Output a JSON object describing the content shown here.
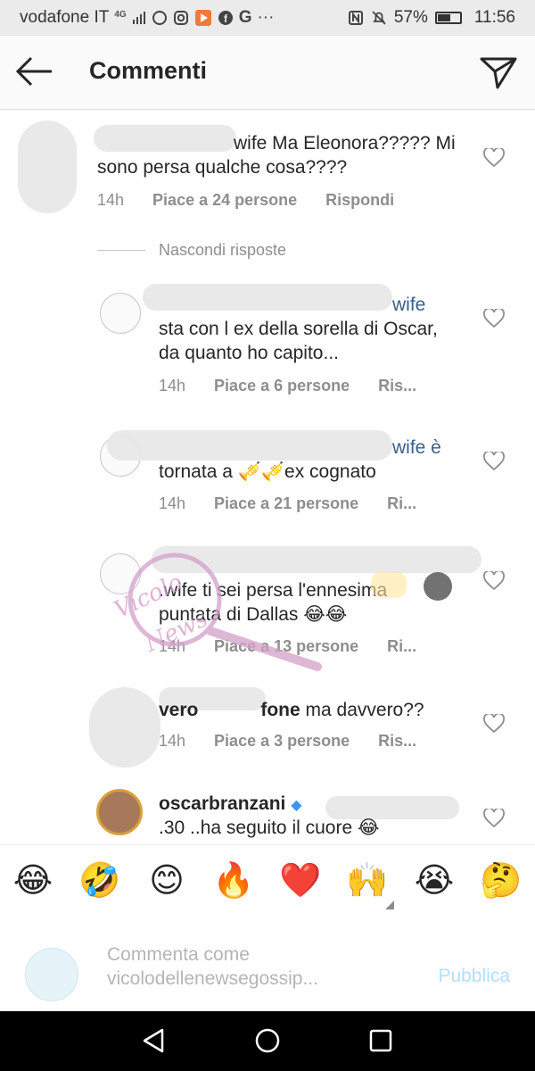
{
  "status_bar": {
    "carrier": "vodafone IT",
    "network": "4G",
    "battery": "57%",
    "time": "11:56",
    "battery_level": 0.57
  },
  "header": {
    "title": "Commenti",
    "back_icon": "arrow-left-icon",
    "send_icon": "paper-plane-icon"
  },
  "comments": [
    {
      "line1": "wife Ma Eleonora????? Mi",
      "line2": "sono persa qualche cosa????",
      "time": "14h",
      "likes": "Piace a 24 persone",
      "reply": "Rispondi"
    }
  ],
  "replies_toggle": "Nascondi risposte",
  "replies": [
    {
      "line1": "wife",
      "line2": "sta con l ex della sorella di Oscar,",
      "line3": "da quanto ho capito...",
      "time": "14h",
      "likes": "Piace a 6 persone",
      "reply": "Ris..."
    },
    {
      "line1": "wife è",
      "line2": "tornata a 🎺🎺ex cognato",
      "time": "14h",
      "likes": "Piace a 21 persone",
      "reply": "Ri..."
    },
    {
      "line1": ".wife ti sei persa l'ennesima",
      "line2": "puntata di Dallas 😂😂",
      "time": "14h",
      "likes": "Piace a 13 persone",
      "reply": "Ri..."
    },
    {
      "line1_user": "vero",
      "line1_user_b": "fone",
      "line1_text": " ma davvero??",
      "time": "14h",
      "likes": "Piace a 3 persone",
      "reply": "Ris..."
    },
    {
      "user": "oscarbranzani",
      "line2": ".30 ..ha seguito il cuore 😂"
    }
  ],
  "reactions": [
    "😂",
    "🤣",
    "😊",
    "🔥",
    "❤️",
    "🙌",
    "😭",
    "🤔"
  ],
  "input": {
    "placeholder_line1": "Commenta come",
    "placeholder_line2": "vicolodellenewsegossip...",
    "publish": "Pubblica"
  },
  "watermark": {
    "text1": "Vicolo",
    "text2": "News"
  },
  "nav": {
    "back_icon": "triangle-back-icon",
    "home_icon": "circle-home-icon",
    "recents_icon": "square-recents-icon"
  }
}
